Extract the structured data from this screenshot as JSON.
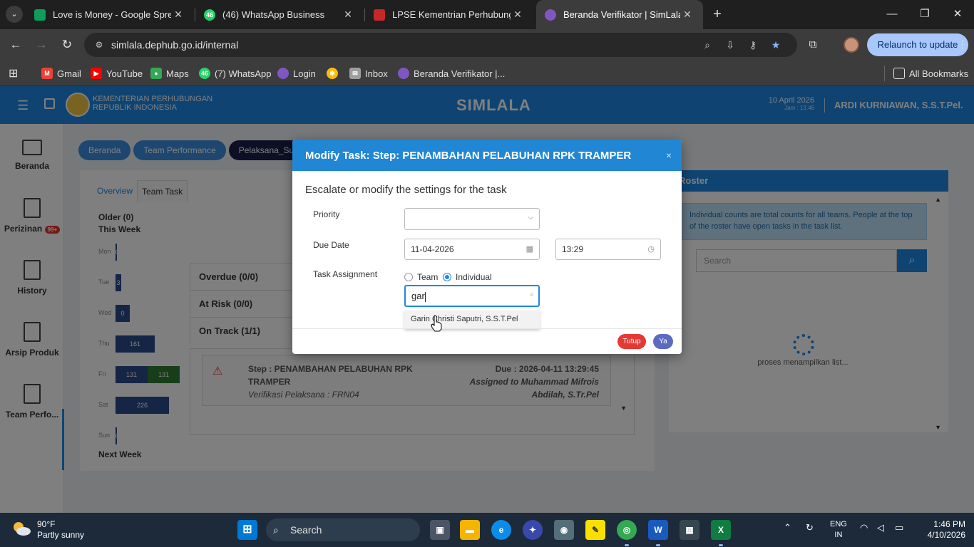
{
  "browser": {
    "tabs": [
      {
        "title": "Love is Money - Google Spread",
        "icon_color": "#0f9d58",
        "icon_text": ""
      },
      {
        "title": "(46) WhatsApp Business",
        "icon_color": "#25d366",
        "icon_text": "46"
      },
      {
        "title": "LPSE Kementrian Perhubungan",
        "icon_color": "#c62828",
        "icon_text": ""
      },
      {
        "title": "Beranda Verifikator | SimLala",
        "icon_color": "#7e57c2",
        "icon_text": ""
      }
    ],
    "url": "simlala.dephub.go.id/internal",
    "relaunch_label": "Relaunch to update",
    "bookmarks": [
      {
        "label": "Gmail",
        "color": "#ea4335"
      },
      {
        "label": "YouTube",
        "color": "#ff0000"
      },
      {
        "label": "Maps",
        "color": "#34a853"
      },
      {
        "label": "(7) WhatsApp",
        "color": "#25d366",
        "icon_text": "46"
      },
      {
        "label": "Login",
        "color": "#7e57c2"
      },
      {
        "label": "",
        "color": "#fbbc04"
      },
      {
        "label": "Inbox",
        "color": "#9e9e9e"
      },
      {
        "label": "Beranda Verifikator |...",
        "color": "#7e57c2"
      }
    ],
    "all_bookmarks": "All Bookmarks"
  },
  "app": {
    "org_line1": "KEMENTERIAN PERHUBUNGAN",
    "org_line2": "REPUBLIK INDONESIA",
    "title": "SIMLALA",
    "date": "10 April 2026",
    "time": "Jam : 13.46",
    "user": "ARDI KURNIAWAN, S.S.T.Pel."
  },
  "nav": [
    {
      "label": "Beranda",
      "badge": ""
    },
    {
      "label": "Perizinan",
      "badge": "99+"
    },
    {
      "label": "History",
      "badge": ""
    },
    {
      "label": "Arsip Produk",
      "badge": ""
    },
    {
      "label": "Team Perfo...",
      "badge": ""
    }
  ],
  "crumbs": [
    "Beranda",
    "Team Performance",
    "Pelaksana_Subdi"
  ],
  "main": {
    "tabs": [
      "Overview",
      "Team Task"
    ],
    "older": "Older (0)",
    "this_week": "This Week",
    "days": [
      {
        "day": "Mon",
        "v1": "0",
        "v1_frac": 0,
        "v2": "",
        "v2_frac": 0
      },
      {
        "day": "Tue",
        "v1": "3",
        "v1_frac": 0.08,
        "v2": "",
        "v2_frac": 0
      },
      {
        "day": "Wed",
        "v1": "0",
        "v1_frac": 0.2,
        "v2": "",
        "v2_frac": 0
      },
      {
        "day": "Thu",
        "v1": "161",
        "v1_frac": 0.55,
        "v2": "",
        "v2_frac": 0
      },
      {
        "day": "Fri",
        "v1": "131",
        "v1_frac": 0.45,
        "v2": "131",
        "v2_frac": 0.45
      },
      {
        "day": "Sat",
        "v1": "226",
        "v1_frac": 0.75,
        "v2": "",
        "v2_frac": 0
      },
      {
        "day": "Sun",
        "v1": "0",
        "v1_frac": 0,
        "v2": "",
        "v2_frac": 0
      }
    ],
    "next_week": "Next Week",
    "accordion": [
      "Overdue (0/0)",
      "At Risk (0/0)",
      "On Track (1/1)"
    ],
    "task": {
      "step": "Step : PENAMBAHAN PELABUHAN RPK TRAMPER",
      "sub": "Verifikasi Pelaksana : FRN04",
      "due": "Due : 2026-04-11 13:29:45",
      "assigned": "Assigned to Muhammad Mifrois Abdilah, S.Tr.Pel"
    }
  },
  "roster": {
    "title": "Roster",
    "info": "Individual counts are total counts for all teams. People at the top of the roster have open tasks in the task list.",
    "search_placeholder": "Search",
    "loading": "proses menampilkan list..."
  },
  "modal": {
    "title": "Modify Task: Step: PENAMBAHAN PELABUHAN RPK TRAMPER",
    "close": "×",
    "description": "Escalate or modify the settings for the task",
    "priority_label": "Priority",
    "priority_value": "",
    "due_label": "Due Date",
    "due_date": "11-04-2026",
    "due_time": "13:29",
    "assignment_label": "Task Assignment",
    "radio_team": "Team",
    "radio_individual": "Individual",
    "selected_radio": "individual",
    "search_value": "gar",
    "suggestion": "Garin Christi Saputri, S.S.T.Pel",
    "btn_close": "Tutup",
    "btn_ok": "Ya"
  },
  "taskbar": {
    "temp": "90°F",
    "weather": "Partly sunny",
    "search": "Search",
    "lang1": "ENG",
    "lang2": "IN",
    "time": "1:46 PM",
    "date": "4/10/2026"
  }
}
